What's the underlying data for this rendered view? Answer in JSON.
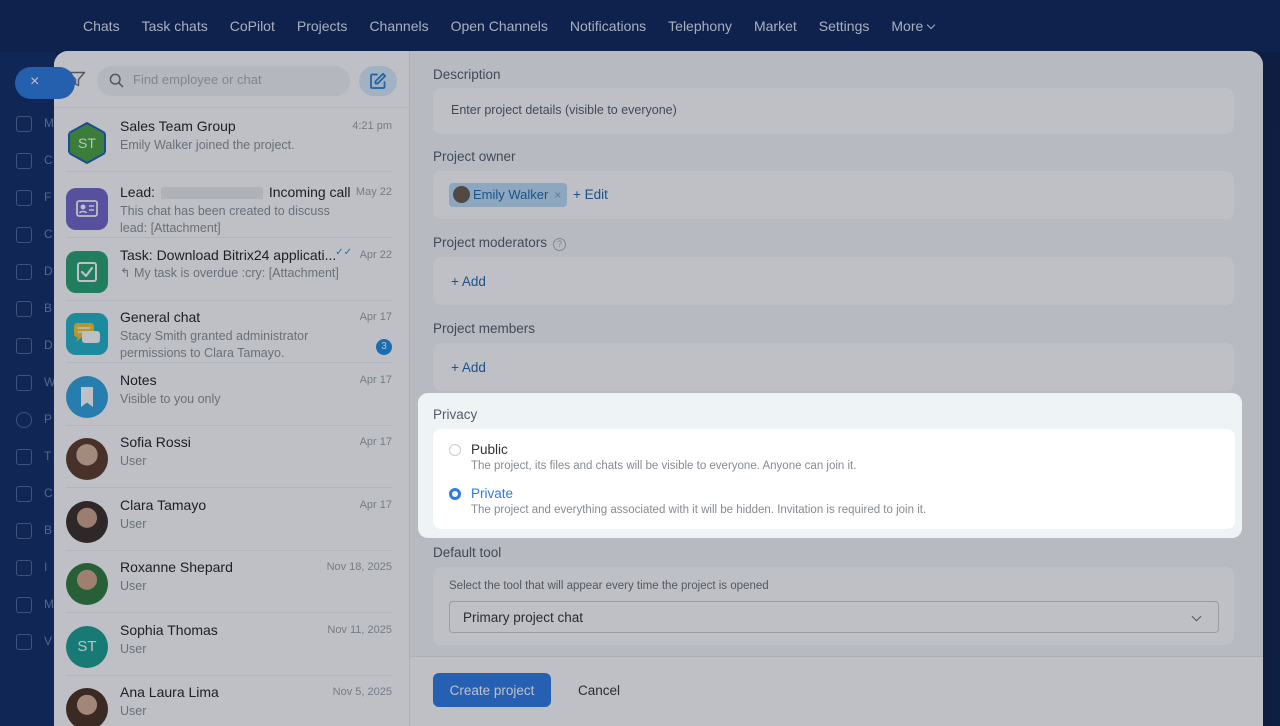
{
  "topnav": {
    "items": [
      "Chats",
      "Task chats",
      "CoPilot",
      "Projects",
      "Channels",
      "Open Channels",
      "Notifications",
      "Telephony",
      "Market",
      "Settings",
      "More"
    ]
  },
  "appside": {
    "close_label": "×",
    "letters": [
      "M",
      "C",
      "F",
      "C",
      "D",
      "B",
      "D",
      "W",
      "P",
      "T",
      "C",
      "B",
      "I",
      "M",
      "V"
    ]
  },
  "chatlist": {
    "search_placeholder": "Find employee or chat",
    "items": [
      {
        "name": "Sales Team Group",
        "preview": "Emily Walker joined the project.",
        "date": "4:21 pm",
        "avatar_text": "ST",
        "avatar_color": "#4aa33d"
      },
      {
        "name_prefix": "Lead:",
        "name_suffix": "Incoming call",
        "preview": "This chat has been created to discuss lead: [Attachment]",
        "date": "May 22",
        "avatar_color": "#7064c9"
      },
      {
        "name": "Task: Download Bitrix24 applicati...",
        "preview": "↰ My task is overdue :cry: [Attachment]",
        "date": "Apr 22",
        "avatar_color": "#26a36f",
        "read_mark": "✓✓"
      },
      {
        "name": "General chat",
        "preview": "Stacy Smith granted administrator permissions to Clara Tamayo.",
        "date": "Apr 17",
        "badge": "3",
        "avatar_color": "#22b5c9"
      },
      {
        "name": "Notes",
        "preview": "Visible to you only",
        "date": "Apr 17",
        "avatar_color": "#2fa3e0"
      },
      {
        "name": "Sofia Rossi",
        "preview": "User",
        "date": "Apr 17"
      },
      {
        "name": "Clara Tamayo",
        "preview": "User",
        "date": "Apr 17"
      },
      {
        "name": "Roxanne Shepard",
        "preview": "User",
        "date": "Nov 18, 2025"
      },
      {
        "name": "Sophia Thomas",
        "preview": "User",
        "date": "Nov 11, 2025",
        "avatar_text": "ST",
        "avatar_color": "#1a9e8f"
      },
      {
        "name": "Ana Laura Lima",
        "preview": "User",
        "date": "Nov 5, 2025"
      }
    ]
  },
  "form": {
    "description_label": "Description",
    "description_placeholder": "Enter project details (visible to everyone)",
    "owner_label": "Project owner",
    "owner_name": "Emily Walker",
    "owner_remove": "×",
    "edit_link": "+ Edit",
    "moderators_label": "Project moderators",
    "moderators_help": "?",
    "moderators_add": "+ Add",
    "members_label": "Project members",
    "members_add": "+ Add",
    "privacy": {
      "title": "Privacy",
      "options": [
        {
          "label": "Public",
          "desc": "The project, its files and chats will be visible to everyone. Anyone can join it.",
          "selected": false
        },
        {
          "label": "Private",
          "desc": "The project and everything associated with it will be hidden. Invitation is required to join it.",
          "selected": true
        }
      ]
    },
    "default_tool_label": "Default tool",
    "default_tool_hint": "Select the tool that will appear every time the project is opened",
    "default_tool_value": "Primary project chat"
  },
  "footer": {
    "create_label": "Create project",
    "cancel_label": "Cancel"
  },
  "colors": {
    "accent": "#2d7be5",
    "link": "#2067b0",
    "nav_bg": "#0d2459"
  }
}
